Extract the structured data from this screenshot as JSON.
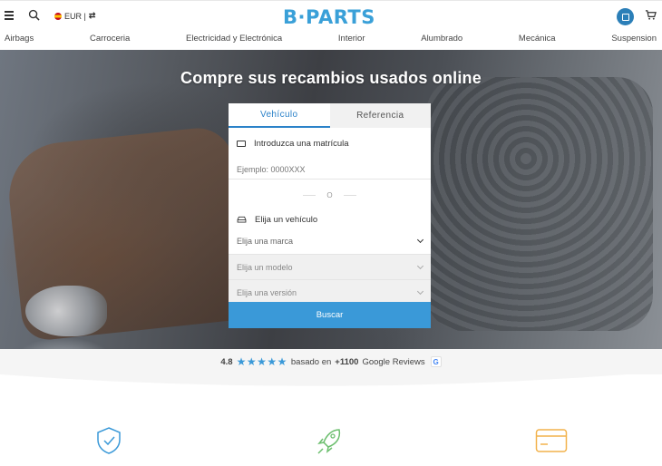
{
  "header": {
    "currency_label": "EUR |",
    "logo_text": "B·PARTS",
    "brand_color": "#3aa0d8"
  },
  "categories": [
    "Airbags",
    "Carroceria",
    "Electricidad y Electrónica",
    "Interior",
    "Alumbrado",
    "Mecánica",
    "Suspension"
  ],
  "hero": {
    "title_pre": "Compre sus ",
    "title_bold": "recambios usados",
    "title_post": " online"
  },
  "search": {
    "tabs": [
      {
        "label": "Vehículo",
        "active": true
      },
      {
        "label": "Referencia",
        "active": false
      }
    ],
    "plate_label": "Introduzca una matrícula",
    "plate_placeholder": "Ejemplo: 0000XXX",
    "or_text": "O",
    "vehicle_label": "Elija un vehículo",
    "brand_select": "Elija una marca",
    "model_select": "Elija un modelo",
    "version_select": "Elija una versión",
    "submit_label": "Buscar",
    "accent_color": "#3a99d8"
  },
  "reviews": {
    "rating": "4.8",
    "stars": "★★★★★",
    "text_pre": "basado en",
    "count": "+1100",
    "text_post": "Google Reviews",
    "google_icon": "G"
  }
}
